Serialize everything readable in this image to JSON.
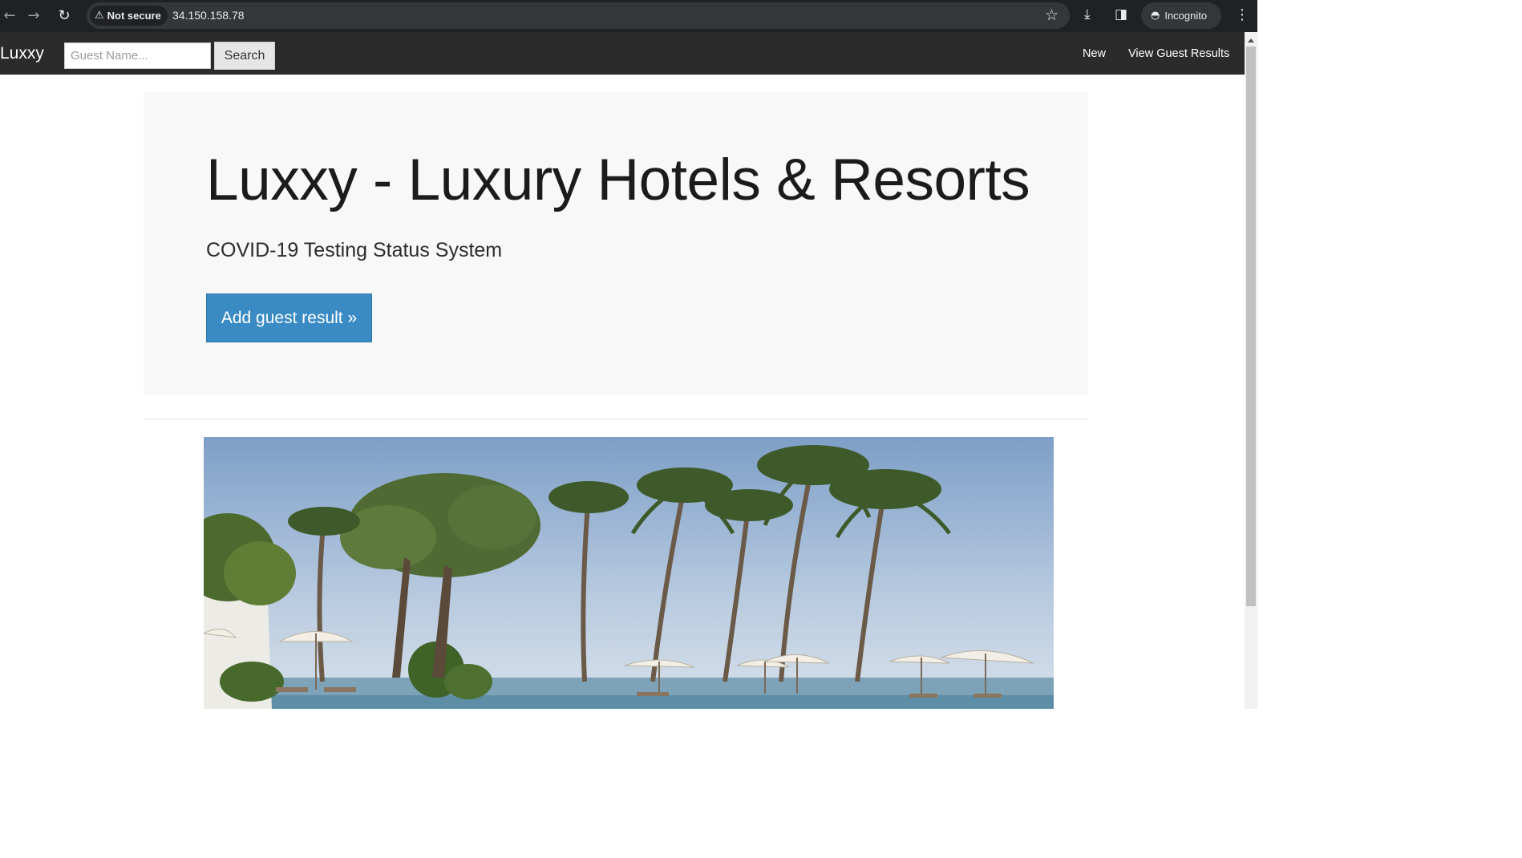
{
  "browser": {
    "security_label": "Not secure",
    "url": "34.150.158.78",
    "profile_label": "Incognito",
    "icons": [
      "back-arrow-icon",
      "forward-arrow-icon",
      "reload-icon",
      "warning-icon",
      "star-icon",
      "download-icon",
      "side-panel-icon",
      "incognito-icon",
      "menu-kebab-icon"
    ]
  },
  "navbar": {
    "brand": "Luxxy",
    "search_placeholder": "Guest Name...",
    "search_value": "",
    "search_button": "Search",
    "links": [
      "New",
      "View Guest Results"
    ]
  },
  "jumbotron": {
    "title": "Luxxy - Luxury Hotels & Resorts",
    "subtitle": "COVID-19 Testing Status System",
    "button": "Add guest result »"
  },
  "colors": {
    "navbar_bg": "#2b2b2b",
    "jumbotron_bg": "#f8f8f8",
    "primary_button": "#3a8bc4",
    "browser_chrome": "#202124"
  }
}
